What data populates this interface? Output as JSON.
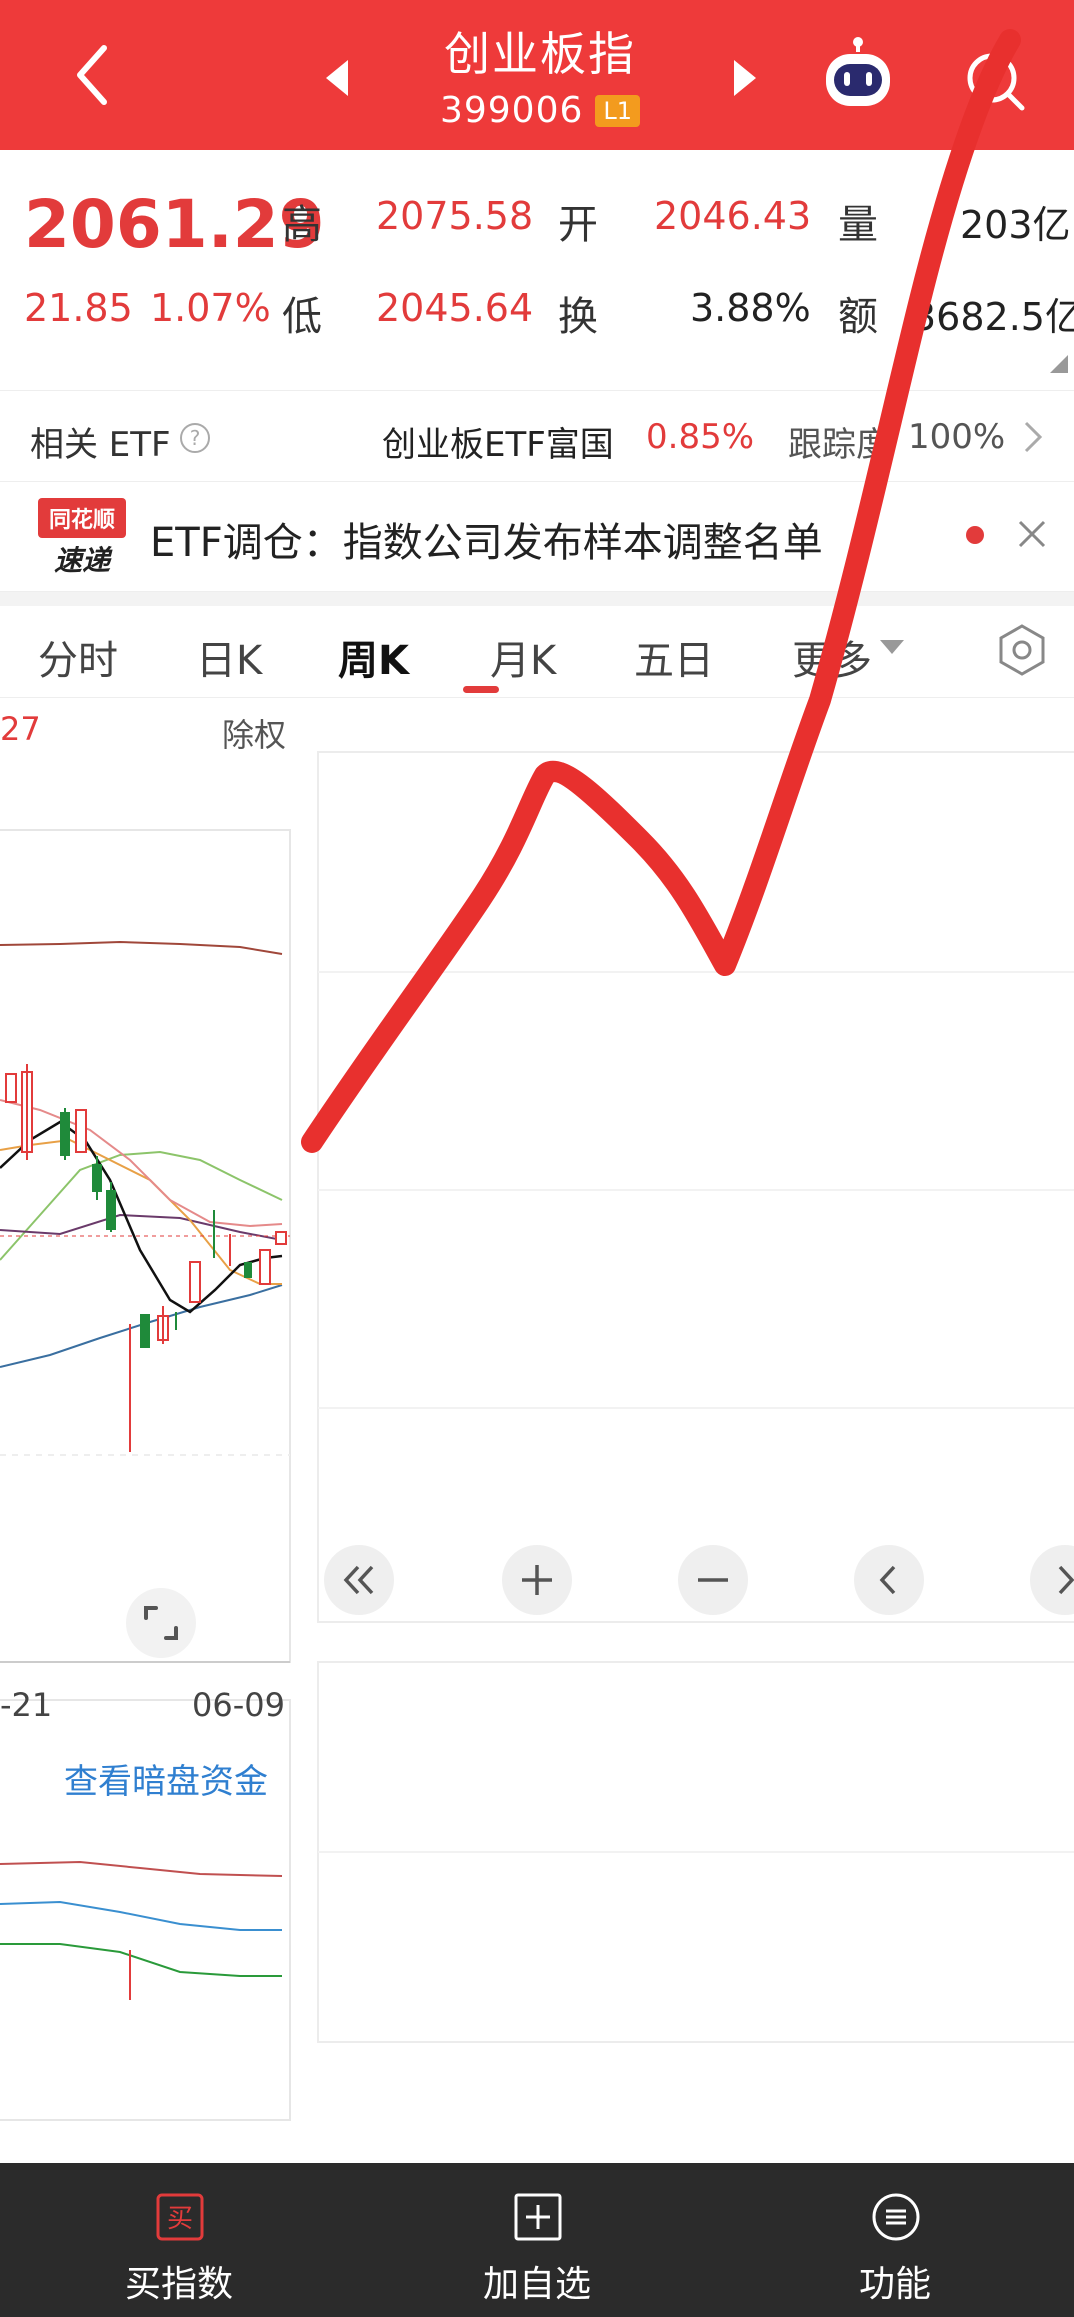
{
  "header": {
    "title": "创业板指",
    "code": "399006",
    "level_badge": "L1",
    "icons": [
      "back-icon",
      "prev-arrow-icon",
      "next-arrow-icon",
      "robot-icon",
      "search-icon"
    ],
    "bg_color": "#ee3a3a"
  },
  "quote": {
    "price": "2061.29",
    "change": "21.85",
    "change_pct": "1.07%",
    "high_label": "高",
    "high": "2075.58",
    "low_label": "低",
    "low": "2045.64",
    "open_label": "开",
    "open": "2046.43",
    "turnover_label": "换",
    "turnover": "3.88%",
    "volume_label": "量",
    "volume": "203亿",
    "amount_label": "额",
    "amount": "3682.5亿"
  },
  "etf": {
    "label": "相关 ETF",
    "name": "创业板ETF富国",
    "pct": "0.85%",
    "tracking_label": "跟踪度",
    "tracking": "100%"
  },
  "news": {
    "logo_top": "同花顺",
    "logo_bottom": "速递",
    "text": "ETF调仓：指数公司发布样本调整名单"
  },
  "tabs": [
    {
      "label": "分时"
    },
    {
      "label": "日K"
    },
    {
      "label": "周K"
    },
    {
      "label": "月K"
    },
    {
      "label": "五日"
    },
    {
      "label": "更多"
    }
  ],
  "active_tab": "周K",
  "chart": {
    "top_left_label": "27",
    "adjust_label": "除权",
    "x_label_left": "-21",
    "x_label_right": "06-09",
    "dark_pool_link": "查看暗盘资金"
  },
  "footer": [
    {
      "label": "买指数",
      "icon": "buy-icon"
    },
    {
      "label": "加自选",
      "icon": "add-watchlist-icon"
    },
    {
      "label": "功能",
      "icon": "menu-icon"
    }
  ],
  "colors": {
    "accent": "#ee3a3a",
    "up": "#e23b3b",
    "down": "#1f8a3a",
    "link": "#2f7fd0",
    "footer_bg": "#2b2b2b"
  }
}
